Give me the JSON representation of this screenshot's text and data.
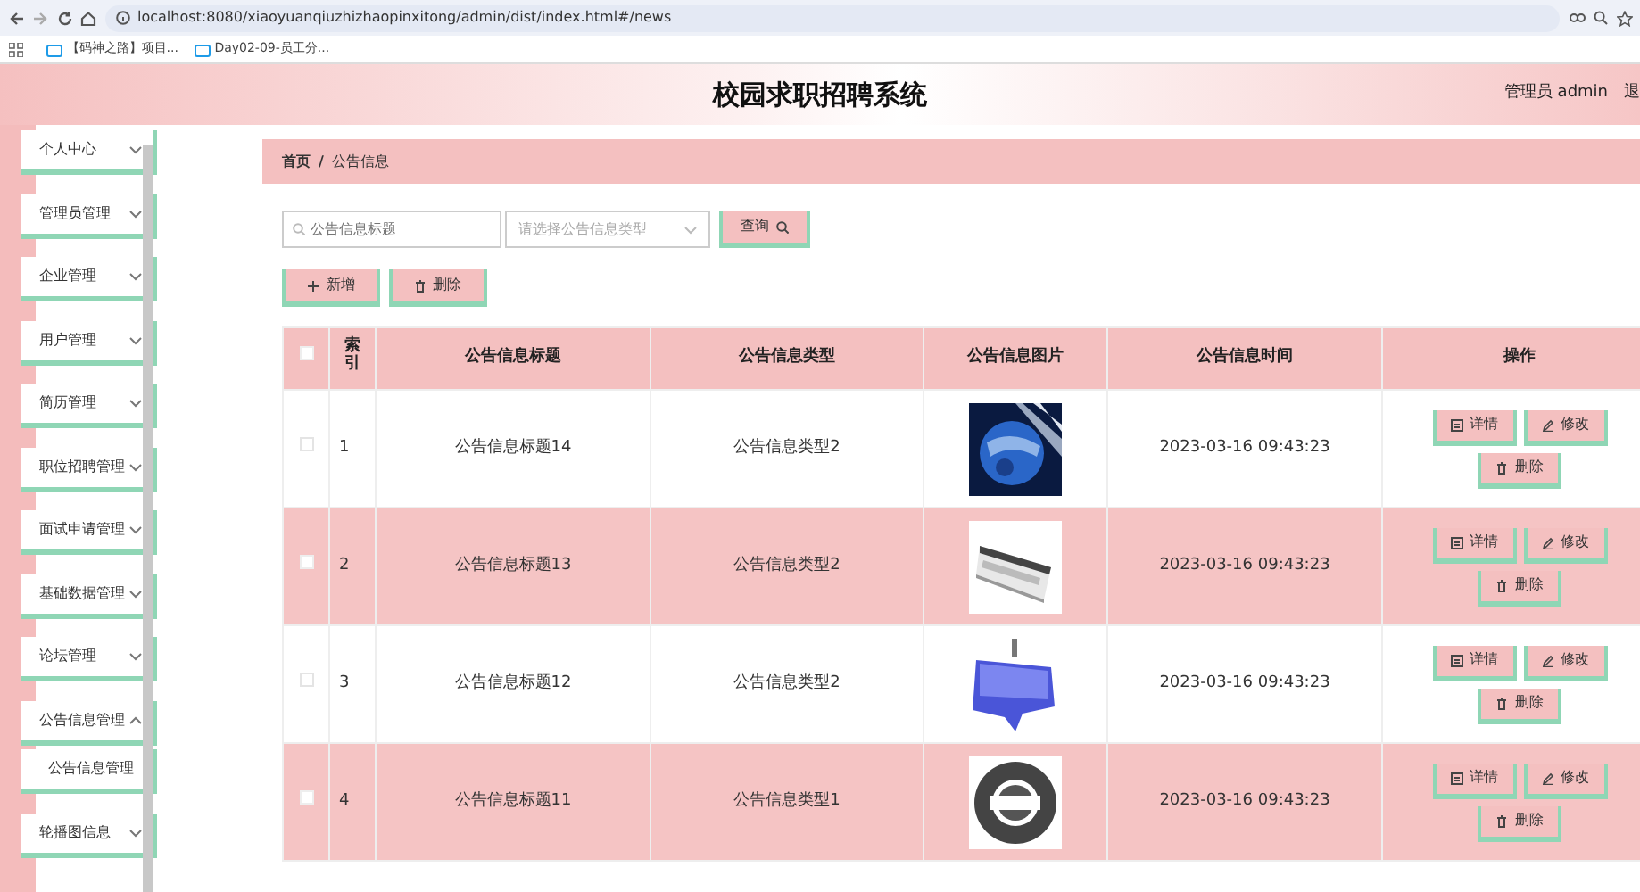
{
  "browser": {
    "url": "localhost:8080/xiaoyuanqiuzhizhaopinxitong/admin/dist/index.html#/news",
    "bookmarks": [
      "【码神之路】项目...",
      "Day02-09-员工分..."
    ]
  },
  "header": {
    "title": "校园求职招聘系统",
    "user": "管理员 admin",
    "logout": "退"
  },
  "sidebar": {
    "items": [
      {
        "label": "个人中心",
        "expanded": false
      },
      {
        "label": "管理员管理",
        "expanded": false
      },
      {
        "label": "企业管理",
        "expanded": false
      },
      {
        "label": "用户管理",
        "expanded": false
      },
      {
        "label": "简历管理",
        "expanded": false
      },
      {
        "label": "职位招聘管理",
        "expanded": false
      },
      {
        "label": "面试申请管理",
        "expanded": false
      },
      {
        "label": "基础数据管理",
        "expanded": false
      },
      {
        "label": "论坛管理",
        "expanded": false
      },
      {
        "label": "公告信息管理",
        "expanded": true,
        "children": [
          {
            "label": "公告信息管理"
          }
        ]
      },
      {
        "label": "轮播图信息",
        "expanded": false
      }
    ]
  },
  "breadcrumb": {
    "items": [
      "首页",
      "公告信息"
    ],
    "separator": "/"
  },
  "search": {
    "title_placeholder": "公告信息标题",
    "type_placeholder": "请选择公告信息类型",
    "button": "查询"
  },
  "actions": [
    {
      "kind": "add",
      "label": "新增"
    },
    {
      "kind": "delete",
      "label": "删除"
    }
  ],
  "table": {
    "columns": [
      "索引",
      "公告信息标题",
      "公告信息类型",
      "公告信息图片",
      "公告信息时间",
      "操作"
    ],
    "header_checked": false,
    "rows": [
      {
        "checked": false,
        "index": "1",
        "title": "公告信息标题14",
        "type": "公告信息类型2",
        "picture": {
          "kind": "picture"
        },
        "time": "2023-03-16 09:43:23",
        "buttons": [
          {
            "kind": "detail",
            "label": "详情"
          },
          {
            "kind": "edit",
            "label": "修改"
          },
          {
            "kind": "delete",
            "label": "删除"
          }
        ]
      },
      {
        "checked": false,
        "index": "2",
        "title": "公告信息标题13",
        "type": "公告信息类型2",
        "picture": {
          "kind": "picture"
        },
        "time": "2023-03-16 09:43:23",
        "buttons": [
          {
            "kind": "detail",
            "label": "详情"
          },
          {
            "kind": "edit",
            "label": "修改"
          },
          {
            "kind": "delete",
            "label": "删除"
          }
        ]
      },
      {
        "checked": false,
        "index": "3",
        "title": "公告信息标题12",
        "type": "公告信息类型2",
        "picture": {
          "kind": "picture"
        },
        "time": "2023-03-16 09:43:23",
        "buttons": [
          {
            "kind": "detail",
            "label": "详情"
          },
          {
            "kind": "edit",
            "label": "修改"
          },
          {
            "kind": "delete",
            "label": "删除"
          }
        ]
      },
      {
        "checked": false,
        "index": "4",
        "title": "公告信息标题11",
        "type": "公告信息类型1",
        "picture": {
          "kind": "picture"
        },
        "time": "2023-03-16 09:43:23",
        "buttons": [
          {
            "kind": "detail",
            "label": "详情"
          },
          {
            "kind": "edit",
            "label": "修改"
          },
          {
            "kind": "delete",
            "label": "删除"
          }
        ]
      }
    ]
  }
}
